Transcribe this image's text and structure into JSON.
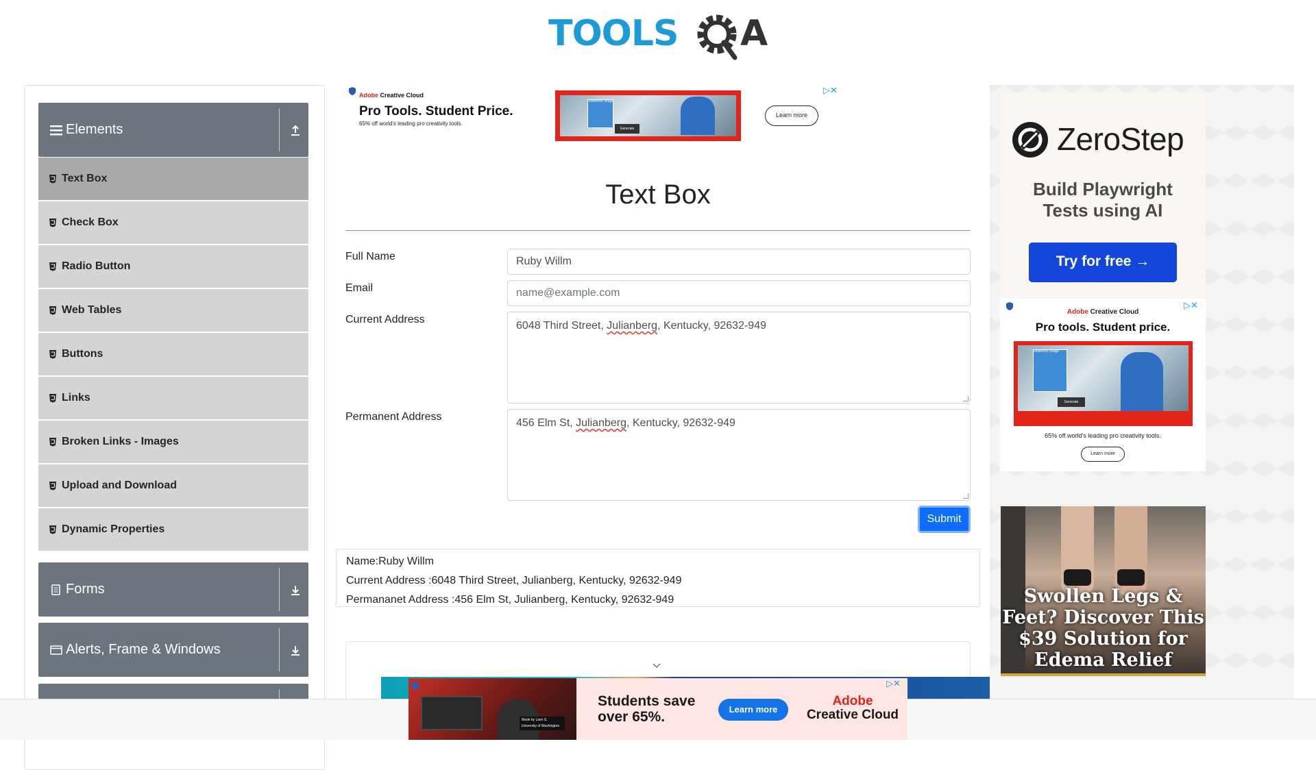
{
  "header": {
    "logo_text": "TOOLSQA"
  },
  "sidebar": {
    "groups": [
      {
        "label": "Elements",
        "expanded": true
      },
      {
        "label": "Forms",
        "expanded": false
      },
      {
        "label": "Alerts, Frame & Windows",
        "expanded": false
      }
    ],
    "items": [
      {
        "label": "Text Box",
        "active": true
      },
      {
        "label": "Check Box"
      },
      {
        "label": "Radio Button"
      },
      {
        "label": "Web Tables"
      },
      {
        "label": "Buttons"
      },
      {
        "label": "Links"
      },
      {
        "label": "Broken Links - Images"
      },
      {
        "label": "Upload and Download"
      },
      {
        "label": "Dynamic Properties"
      }
    ]
  },
  "main": {
    "title": "Text Box",
    "form": {
      "full_name_label": "Full Name",
      "full_name_value": "Ruby Willm",
      "email_label": "Email",
      "email_placeholder": "name@example.com",
      "current_address_label": "Current Address",
      "current_address_value": {
        "pre": "6048 Third Street, ",
        "word": "Julianberg",
        "post": ", Kentucky, 92632-949"
      },
      "permanent_address_label": "Permanent Address",
      "permanent_address_value": {
        "pre": "456 Elm St, ",
        "word": "Julianberg",
        "post": ", Kentucky, 92632-949"
      },
      "submit_label": "Submit"
    },
    "output": {
      "name": "Name:Ruby Willm",
      "current_address": "Current Address :6048 Third Street, Julianberg, Kentucky, 92632-949",
      "permanent_address": "Permananet Address :456 Elm St, Julianberg, Kentucky, 92632-949"
    }
  },
  "ads": {
    "top": {
      "brand_prefix": "Adobe",
      "brand_suffix": " Creative Cloud",
      "title": "Pro Tools. Student Price.",
      "subtitle": "65% off world's leading pro creativity tools.",
      "cta": "Learn more",
      "image_labels": [
        "Reference image",
        "Generate"
      ]
    },
    "zerostep": {
      "name": "ZeroStep",
      "line1": "Build Playwright",
      "line2": "Tests using AI",
      "cta": "Try for free →"
    },
    "adobe_right": {
      "brand_prefix": "Adobe",
      "brand_suffix": " Creative Cloud",
      "title": "Pro tools. Student price.",
      "subtitle": "65% off world's leading pro creativity tools.",
      "cta": "Learn more",
      "image_labels": [
        "Reference image",
        "Generate"
      ]
    },
    "legs": {
      "text": "Swollen Legs & Feet? Discover This $39 Solution for Edema Relief"
    },
    "bottom": {
      "headline_1": "Students save",
      "headline_2": "over 65%.",
      "cta": "Learn more",
      "brand_1": "Adobe",
      "brand_2": "Creative Cloud",
      "photo_caption_1": "Made by Liam S.",
      "photo_caption_2": "University of Washington"
    }
  },
  "colors": {
    "sidebar_header": "#6c757d",
    "menu_item": "#d4d4d4",
    "menu_item_active": "#a9a9a9",
    "submit": "#0d6efd",
    "logo_blue": "#1e9bd7",
    "logo_dark": "#333333"
  }
}
